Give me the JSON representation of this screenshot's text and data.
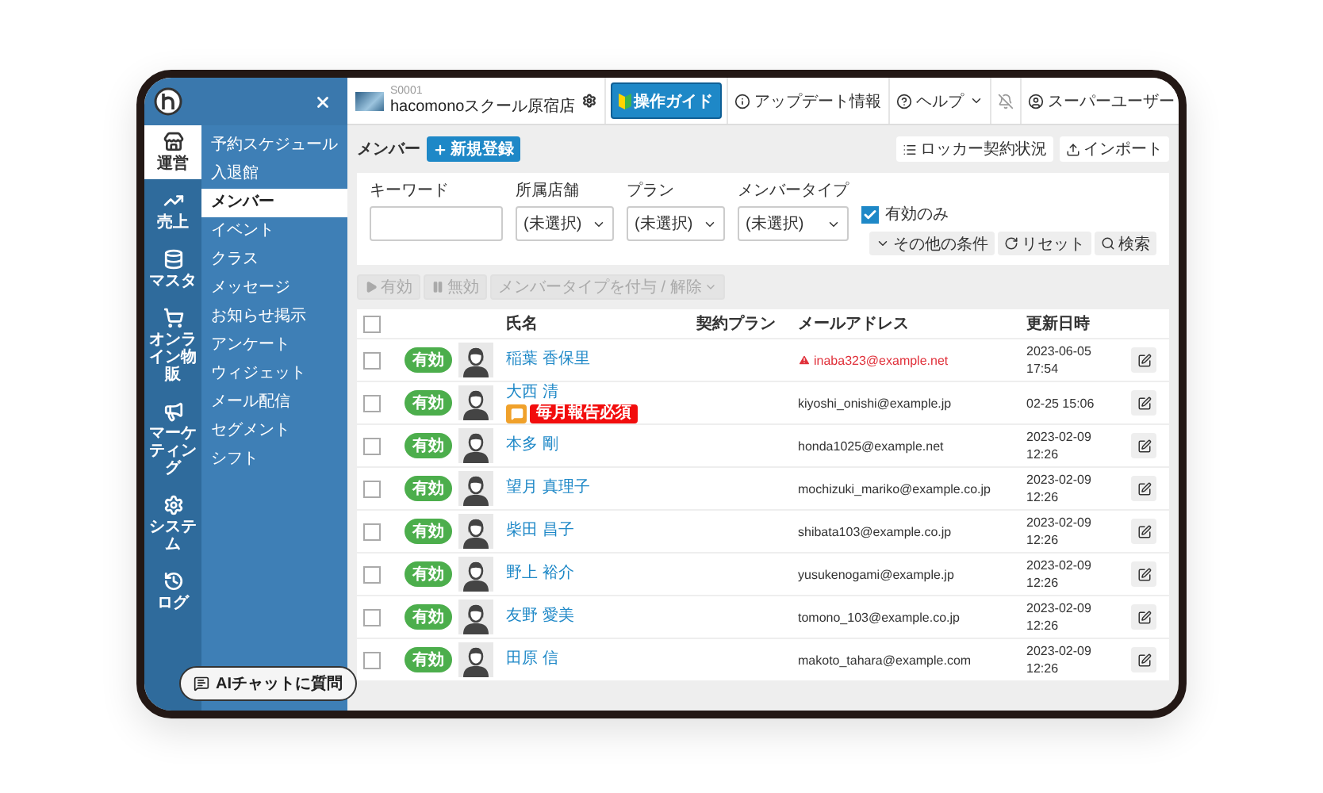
{
  "store": {
    "code": "S0001",
    "name": "hacomonoスクール原宿店"
  },
  "guide_button": "操作ガイド",
  "topbar": {
    "update": "アップデート情報",
    "help": "ヘルプ",
    "user": "スーパーユーザー"
  },
  "rail": [
    {
      "kind": "store",
      "label": "運営",
      "selected": true
    },
    {
      "kind": "sales",
      "label": "売上",
      "selected": false
    },
    {
      "kind": "master",
      "label": "マスタ",
      "selected": false
    },
    {
      "kind": "shop",
      "label": "オンライン物販",
      "selected": false
    },
    {
      "kind": "marketing",
      "label": "マーケティング",
      "selected": false
    },
    {
      "kind": "system",
      "label": "システム",
      "selected": false
    },
    {
      "kind": "log",
      "label": "ログ",
      "selected": false
    }
  ],
  "submenu": [
    {
      "label": "予約スケジュール",
      "selected": false
    },
    {
      "label": "入退館",
      "selected": false
    },
    {
      "label": "メンバー",
      "selected": true
    },
    {
      "label": "イベント",
      "selected": false
    },
    {
      "label": "クラス",
      "selected": false
    },
    {
      "label": "メッセージ",
      "selected": false
    },
    {
      "label": "お知らせ掲示",
      "selected": false
    },
    {
      "label": "アンケート",
      "selected": false
    },
    {
      "label": "ウィジェット",
      "selected": false
    },
    {
      "label": "メール配信",
      "selected": false
    },
    {
      "label": "セグメント",
      "selected": false
    },
    {
      "label": "シフト",
      "selected": false
    }
  ],
  "ai_chat_button": "AIチャットに質問",
  "page": {
    "title": "メンバー",
    "new_button": "新規登録",
    "locker_button": "ロッカー契約状況",
    "import_button": "インポート"
  },
  "filters": {
    "keyword": {
      "label": "キーワード"
    },
    "selects": [
      {
        "label": "所属店舗",
        "value": "(未選択)"
      },
      {
        "label": "プラン",
        "value": "(未選択)"
      },
      {
        "label": "メンバータイプ",
        "value": "(未選択)"
      }
    ],
    "active_only": {
      "label": "有効のみ",
      "checked": true
    },
    "more_button": "その他の条件",
    "reset_button": "リセット",
    "search_button": "検索"
  },
  "bulk_actions": [
    {
      "kind": "play",
      "label": "有効",
      "disabled": true
    },
    {
      "kind": "pause",
      "label": "無効",
      "disabled": true
    },
    {
      "kind": "dropdown",
      "label": "メンバータイプを付与 / 解除",
      "disabled": true
    }
  ],
  "table": {
    "select_all": false,
    "columns": [
      "氏名",
      "契約プラン",
      "メールアドレス",
      "更新日時"
    ],
    "rows": [
      {
        "selected": false,
        "status": "有効",
        "kind": "female",
        "name": "稲葉 香保里",
        "tags": [],
        "email": "inaba323@example.net",
        "email_warning": true,
        "updated": [
          "2023-06-05",
          "17:54"
        ]
      },
      {
        "selected": false,
        "status": "有効",
        "kind": "male",
        "name": "大西 清",
        "tags": [
          {
            "kind": "memo",
            "color": "#f0a12b"
          },
          {
            "kind": "label",
            "text": "毎月報告必須",
            "color": "#f20d0d"
          }
        ],
        "email": "kiyoshi_onishi@example.jp",
        "email_warning": false,
        "updated": [
          "02-25 15:06"
        ]
      },
      {
        "selected": false,
        "status": "有効",
        "kind": "male",
        "name": "本多 剛",
        "tags": [],
        "email": "honda1025@example.net",
        "email_warning": false,
        "updated": [
          "2023-02-09",
          "12:26"
        ]
      },
      {
        "selected": false,
        "status": "有効",
        "kind": "female",
        "name": "望月 真理子",
        "tags": [],
        "email": "mochizuki_mariko@example.co.jp",
        "email_warning": false,
        "updated": [
          "2023-02-09",
          "12:26"
        ]
      },
      {
        "selected": false,
        "status": "有効",
        "kind": "female",
        "name": "柴田 昌子",
        "tags": [],
        "email": "shibata103@example.co.jp",
        "email_warning": false,
        "updated": [
          "2023-02-09",
          "12:26"
        ]
      },
      {
        "selected": false,
        "status": "有効",
        "kind": "male",
        "name": "野上 裕介",
        "tags": [],
        "email": "yusukenogami@example.jp",
        "email_warning": false,
        "updated": [
          "2023-02-09",
          "12:26"
        ]
      },
      {
        "selected": false,
        "status": "有効",
        "kind": "female",
        "name": "友野 愛美",
        "tags": [],
        "email": "tomono_103@example.co.jp",
        "email_warning": false,
        "updated": [
          "2023-02-09",
          "12:26"
        ]
      },
      {
        "selected": false,
        "status": "有効",
        "kind": "male",
        "name": "田原 信",
        "tags": [],
        "email": "makoto_tahara@example.com",
        "email_warning": false,
        "updated": [
          "2023-02-09",
          "12:26"
        ]
      }
    ]
  }
}
